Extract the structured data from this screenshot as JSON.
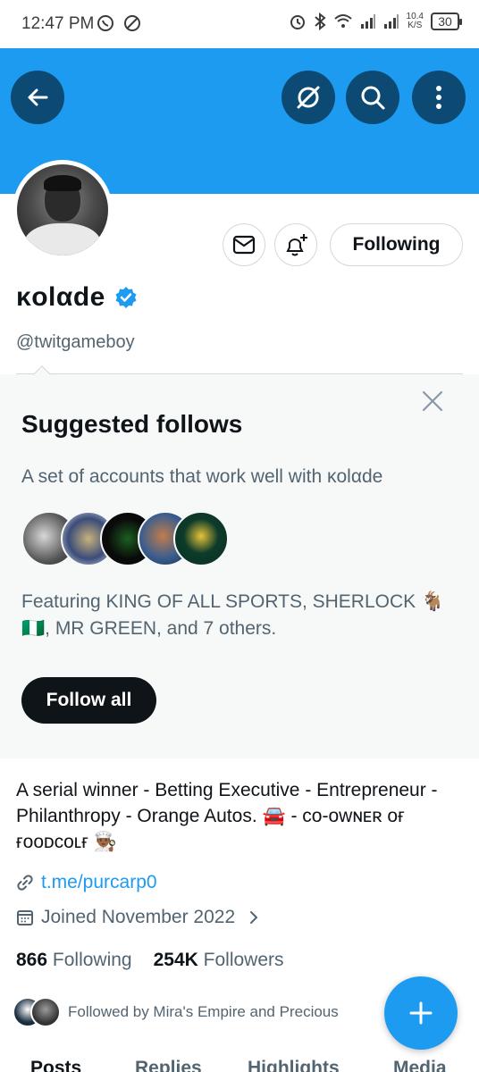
{
  "status_bar": {
    "time": "12:47 PM",
    "speed_value": "10.4",
    "speed_unit": "K/S",
    "battery": "30"
  },
  "profile": {
    "display_name": "κolαde",
    "handle": "@twitgameboy",
    "verified": true,
    "following_button": "Following"
  },
  "suggested": {
    "title": "Suggested follows",
    "subtitle": "A set of accounts that work well with κolαde",
    "featuring": "Featuring KING OF ALL SPORTS, SHERLOCK 🐐 🇳🇬, MR GREEN, and 7 others.",
    "follow_all": "Follow all"
  },
  "bio": {
    "text": "A serial winner  - Betting Executive - Entrepreneur - Philanthropy - Orange Autos. 🚘 - ᴄᴏ-ᴏᴡɴᴇʀ ᴏғ ғᴏᴏᴅᴄᴏʟғ 👨🏾‍🍳",
    "link": "t.me/purcarp0",
    "joined": "Joined November 2022"
  },
  "stats": {
    "following_count": "866",
    "following_label": "Following",
    "followers_count": "254K",
    "followers_label": "Followers"
  },
  "followed_by": "Followed by Mira's Empire and Precious",
  "tabs": [
    "Posts",
    "Replies",
    "Highlights",
    "Media"
  ],
  "colors": {
    "accent": "#1d9bf0",
    "banner_button": "#0d4a73",
    "text_primary": "#0f1419",
    "text_secondary": "#536471"
  },
  "icons": [
    "back-arrow-icon",
    "grok-icon",
    "search-icon",
    "more-vertical-icon",
    "mail-icon",
    "bell-plus-icon",
    "verified-badge-icon",
    "close-icon",
    "link-icon",
    "calendar-icon",
    "chevron-right-icon",
    "plus-icon"
  ]
}
